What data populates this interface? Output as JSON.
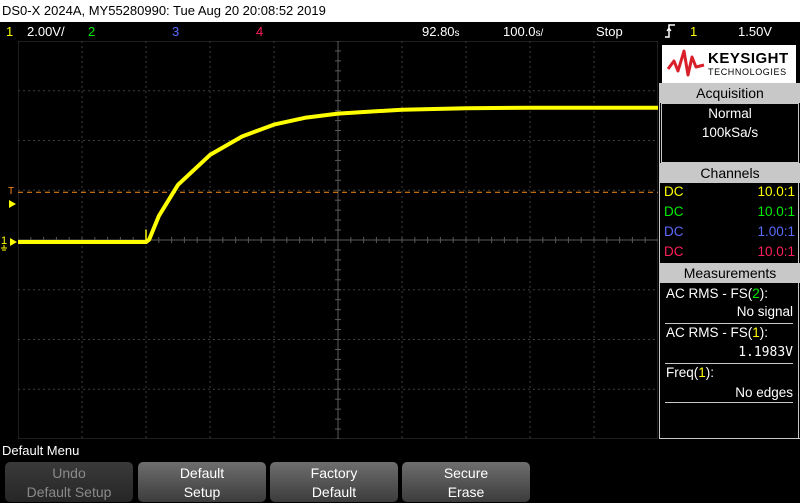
{
  "title": "DS0-X 2024A, MY55280990: Tue Aug 20 20:08:52 2019",
  "status": {
    "ch1_num": "1",
    "ch1_scale": "2.00V/",
    "ch2_num": "2",
    "ch3_num": "3",
    "ch4_num": "4",
    "time_pos": "92.80",
    "time_pos_unit": "s",
    "time_scale": "100.0",
    "time_scale_unit": "s/",
    "run_state": "Stop",
    "trig_slope_icon": "rising-edge-icon",
    "trig_ch": "1",
    "trig_level": "1.50V"
  },
  "colors": {
    "ch1": "#ffff00",
    "ch2": "#00ee00",
    "ch3": "#5a6aff",
    "ch4": "#ff1f5a",
    "accent": "#ff8c1a",
    "panel_head_bg": "#c8c8c8"
  },
  "logo": {
    "line1": "KEYSIGHT",
    "line2": "TECHNOLOGIES"
  },
  "acquisition": {
    "heading": "Acquisition",
    "mode": "Normal",
    "rate": "100kSa/s"
  },
  "channels": {
    "heading": "Channels",
    "rows": [
      {
        "coupling": "DC",
        "probe": "10.0:1"
      },
      {
        "coupling": "DC",
        "probe": "10.0:1"
      },
      {
        "coupling": "DC",
        "probe": "1.00:1"
      },
      {
        "coupling": "DC",
        "probe": "10.0:1"
      }
    ]
  },
  "measurements": {
    "heading": "Measurements",
    "items": [
      {
        "label_pre": "AC RMS - FS(",
        "src": "2",
        "label_post": "):",
        "value": "No signal"
      },
      {
        "label_pre": "AC RMS - FS(",
        "src": "1",
        "label_post": "):",
        "value": "1.1983V"
      },
      {
        "label_pre": "Freq(",
        "src": "1",
        "label_post": "):",
        "value": "No edges"
      }
    ]
  },
  "markers": {
    "trigger_letter": "T",
    "ch1_ground": "1"
  },
  "menu": {
    "title": "Default Menu",
    "keys": [
      {
        "line1": "Undo",
        "line2": "Default Setup",
        "enabled": false
      },
      {
        "line1": "Default",
        "line2": "Setup",
        "enabled": true
      },
      {
        "line1": "Factory",
        "line2": "Default",
        "enabled": true
      },
      {
        "line1": "Secure",
        "line2": "Erase",
        "enabled": true
      }
    ]
  },
  "chart_data": {
    "type": "line",
    "x_divisions": 10,
    "y_divisions": 8,
    "trigger_level_div": 1.0,
    "series": [
      {
        "x": [
          0,
          2.0,
          2.05,
          2.2,
          2.5,
          3.0,
          3.5,
          4.0,
          4.5,
          5.0,
          6.0,
          7.0,
          8.0,
          10.0
        ],
        "y": [
          0,
          0,
          0.05,
          0.52,
          1.15,
          1.75,
          2.12,
          2.36,
          2.5,
          2.58,
          2.66,
          2.69,
          2.7,
          2.7
        ]
      }
    ]
  }
}
